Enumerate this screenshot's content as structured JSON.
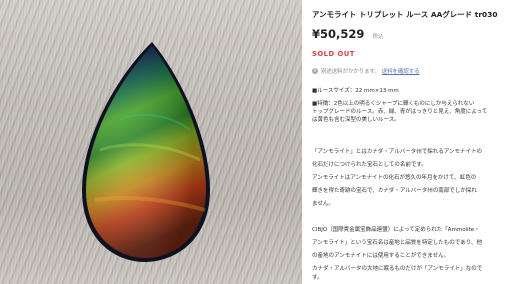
{
  "product": {
    "title": "アンモライト トリプレット ルース AAグレード tr030",
    "price": "¥50,529",
    "tax_note": "税込",
    "status": "SOLD OUT"
  },
  "shipping": {
    "note": "別途送料がかかります。",
    "link": "送料を確認する",
    "icon": "info-icon"
  },
  "description": {
    "lines": [
      "■ルースサイズ：22 mm×13 mm",
      "■特徴：2色以上の明るくシャープに輝くものにしか与えられない",
      "トップグレードのルース。赤、緑、青がはっきりと見え、角度によって",
      "は黄色も含む深型の美しいルース。",
      "「アンモライト」とはカナダ・アルバータ州で採れるアンモナイトの",
      "化石だけにつけられた宝石としての名前です。",
      "アンモライトはアンモナイトの化石が悠久の年月をかけて、虹色の",
      "輝きを得た奇跡の宝石で、カナダ・アルバータ州の南部でしか採れ",
      "ません。",
      "CIBJO（国際貴金属宝飾品連盟）によって定められた「Ammolite・",
      "アンモライト」という宝石名は産地と品質を特定したものであり、他",
      "の産地のアンモナイトには使用することができません。",
      "カナダ・アルバータの大地に眠るものだけが「アンモライト」なので",
      "す。"
    ]
  },
  "colors": {
    "sold_out": "#d04848",
    "link": "#5577aa",
    "price": "#222222"
  }
}
